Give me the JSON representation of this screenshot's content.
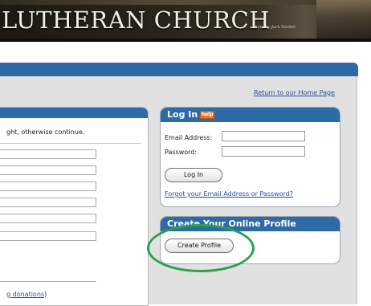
{
  "banner": {
    "title": "LUTHERAN CHURCH",
    "photo_credit": "Photo by Jack Decker"
  },
  "home_link": "Return to our Home Page",
  "left_panel": {
    "instruction": "ght, otherwise continue.",
    "donations_link": "g donations",
    "donations_suffix": ")"
  },
  "login": {
    "title": "Log In",
    "help_badge": "help",
    "email_label": "Email Address:",
    "email_value": "",
    "password_label": "Password:",
    "password_value": "",
    "button": "Log In",
    "forgot_link": "Forgot your Email Address or Password?"
  },
  "create_profile": {
    "title": "Create Your Online Profile",
    "button": "Create Profile"
  },
  "colors": {
    "header_blue": "#2e6aa6",
    "highlight_green": "#2aa14a",
    "link_blue": "#2050a0",
    "help_orange": "#e57a2c"
  }
}
